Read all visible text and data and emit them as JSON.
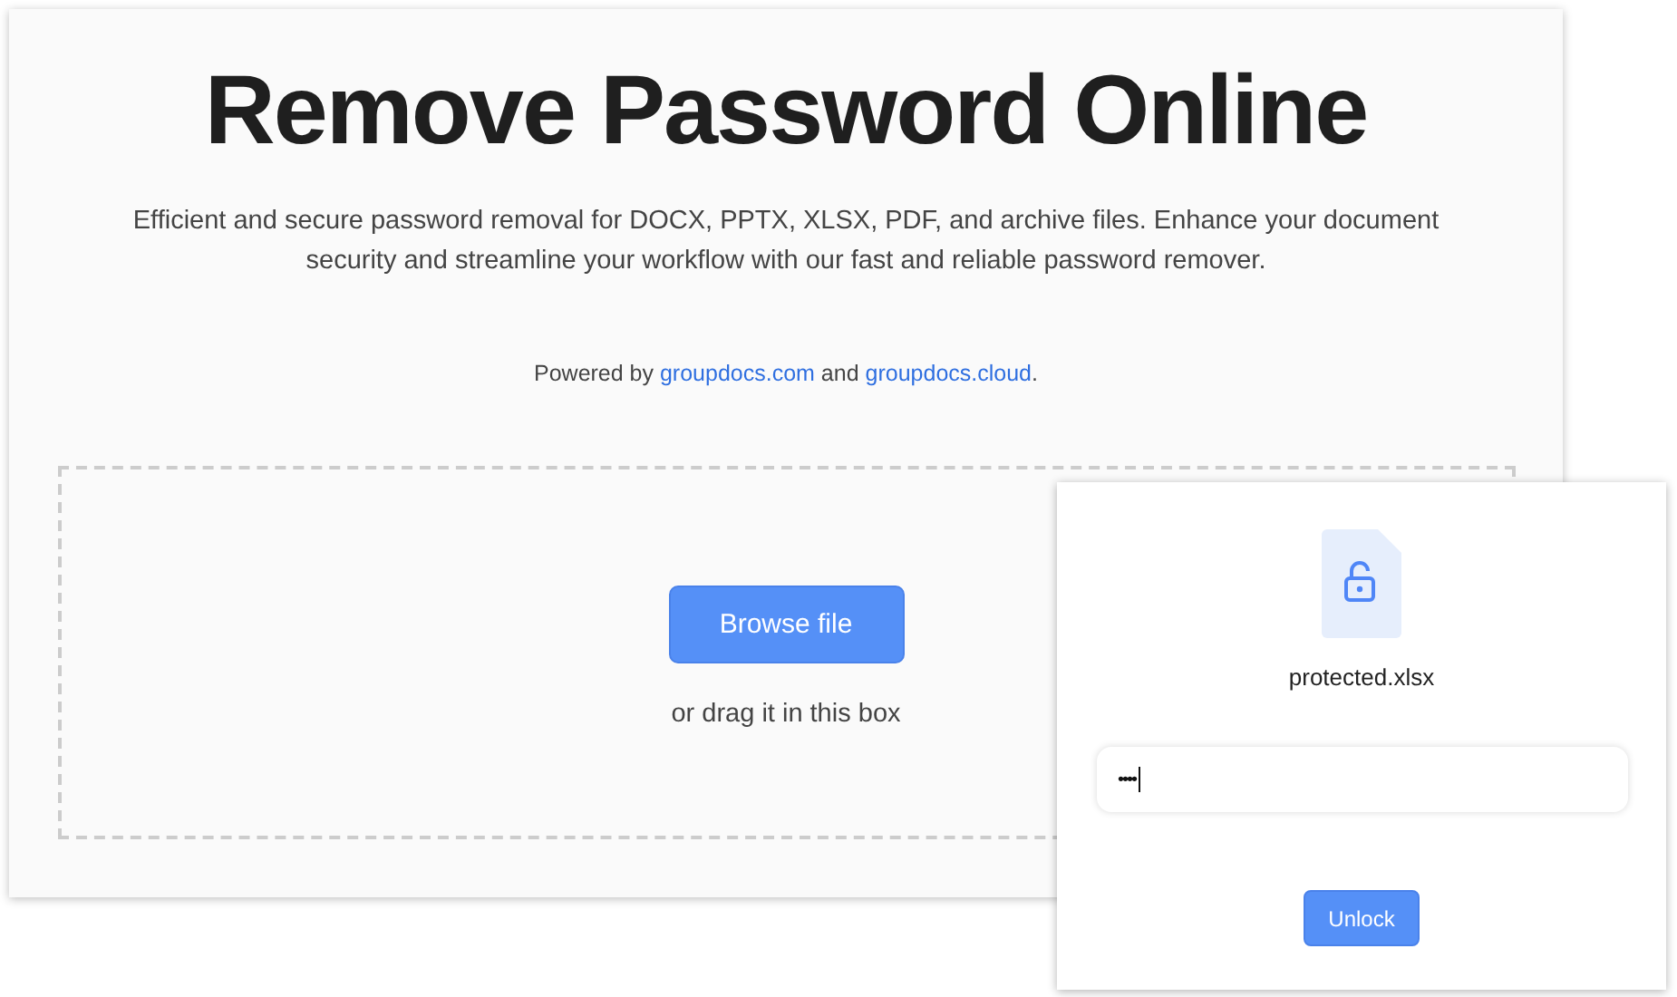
{
  "page": {
    "title": "Remove Password Online",
    "description": "Efficient and secure password removal for DOCX, PPTX, XLSX, PDF, and archive files. Enhance your document security and streamline your workflow with our fast and reliable password remover.",
    "powered_by": {
      "prefix": "Powered by",
      "links": [
        "groupdocs.com",
        "groupdocs.cloud"
      ],
      "joiner": "and",
      "suffix": "."
    },
    "dropzone": {
      "button": "Browse file",
      "hint": "or drag it in this box"
    }
  },
  "dialog": {
    "file_name": "protected.xlsx",
    "password": {
      "value": "••••"
    },
    "button": "Unlock"
  }
}
